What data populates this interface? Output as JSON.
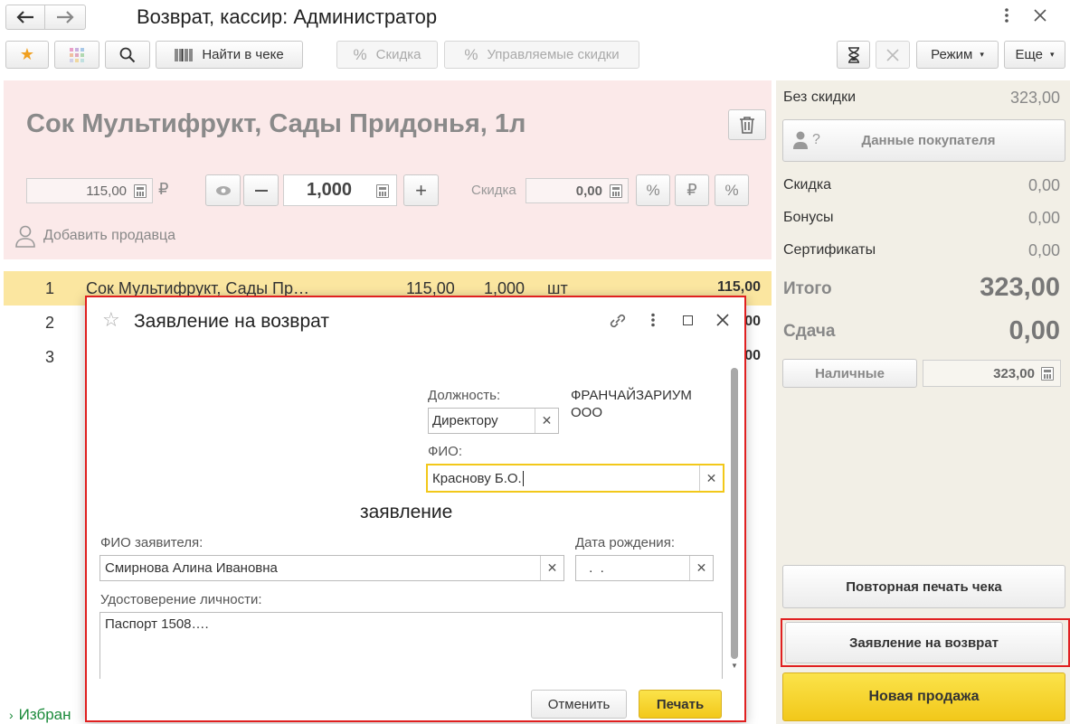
{
  "window": {
    "title": "Возврат, кассир: Администратор",
    "back_icon": "arrow-left-icon",
    "forward_icon": "arrow-right-icon"
  },
  "toolbar": {
    "find_in_check": "Найти в чеке",
    "discount": "Скидка",
    "managed_discounts": "Управляемые скидки",
    "mode": "Режим",
    "more": "Еще"
  },
  "product": {
    "name": "Сок Мультифрукт, Сады Придонья, 1л",
    "price": "115,00",
    "currency": "₽",
    "quantity": "1,000",
    "discount_label": "Скидка",
    "discount_value": "0,00",
    "add_seller": "Добавить продавца"
  },
  "table": {
    "rows": [
      {
        "num": "1",
        "name": "Сок Мультифрукт, Сады Пр…",
        "price": "115,00",
        "qty": "1,000",
        "unit": "шт",
        "sum": "115,00"
      },
      {
        "num": "2",
        "sum": "00"
      },
      {
        "num": "3",
        "sum": "00"
      }
    ]
  },
  "favorites_label": "Избран",
  "summary": {
    "no_discount_label": "Без скидки",
    "no_discount_value": "323,00",
    "customer_data": "Данные покупателя",
    "discount_label": "Скидка",
    "discount_value": "0,00",
    "bonus_label": "Бонусы",
    "bonus_value": "0,00",
    "certificates_label": "Сертификаты",
    "certificates_value": "0,00",
    "total_label": "Итого",
    "total_value": "323,00",
    "change_label": "Сдача",
    "change_value": "0,00",
    "cash_label": "Наличные",
    "cash_value": "323,00",
    "reprint": "Повторная печать чека",
    "return_statement": "Заявление на возврат",
    "new_sale": "Новая продажа"
  },
  "dialog": {
    "title": "Заявление на возврат",
    "position_label": "Должность:",
    "position_value": "Директору",
    "org_name": "ФРАНЧАЙЗАРИУМ ООО",
    "fio_label": "ФИО:",
    "fio_value": "Краснову Б.О.",
    "heading": "заявление",
    "applicant_label": "ФИО заявителя:",
    "applicant_value": "Смирнова Алина Ивановна",
    "birth_label": "Дата рождения:",
    "birth_value": " .  .",
    "id_label": "Удостоверение личности:",
    "id_value": "Паспорт 1508….",
    "cancel": "Отменить",
    "print": "Печать"
  },
  "colors": {
    "accent_yellow": "#f5d21c",
    "highlight_red": "#e02020",
    "product_bg": "#fbe9e9",
    "row_selected": "#fbe6a0",
    "sidebar_bg": "#f2efe6"
  }
}
